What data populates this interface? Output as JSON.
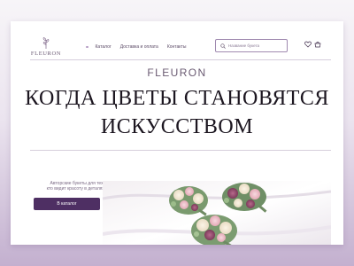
{
  "brand": {
    "logo_text": "FLEURON"
  },
  "nav": {
    "items": [
      "Каталог",
      "Доставка и оплата",
      "Контакты"
    ]
  },
  "search": {
    "placeholder": "Название букета"
  },
  "header_icons": [
    "heart-icon",
    "cart-icon",
    "search-icon",
    "leaf-logo-icon"
  ],
  "hero": {
    "brand": "FLEURON",
    "title_line1": "КОГДА ЦВЕТЫ СТАНОВЯТСЯ",
    "title_line2": "ИСКУССТВОМ"
  },
  "promo": {
    "line1": "Авторские букеты для тех,",
    "line2": "кто видит красоту в деталях",
    "button_label": "В каталог"
  },
  "colors": {
    "accent": "#4e2f63",
    "text": "#1c1620",
    "muted": "#7a6a84",
    "background_top": "#f7f5f8",
    "background_bottom": "#c3b0cf"
  }
}
